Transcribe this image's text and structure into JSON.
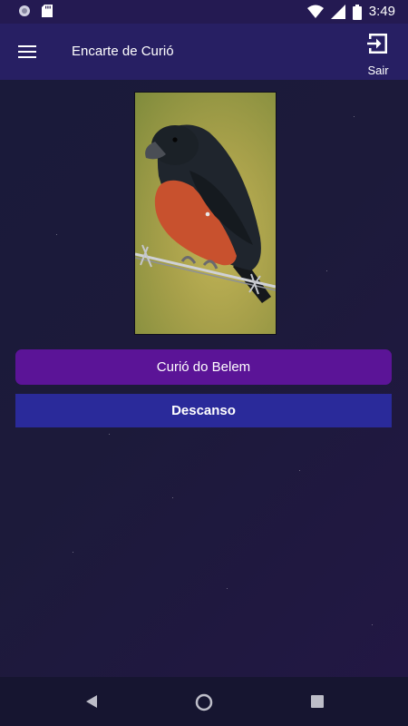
{
  "status_bar": {
    "time": "3:49",
    "icons": [
      "media-icon",
      "sd-card-icon",
      "wifi-icon",
      "cell-signal-icon",
      "battery-icon"
    ]
  },
  "app_bar": {
    "title": "Encarte de Curió",
    "menu_icon": "hamburger-menu-icon",
    "exit_icon": "exit-icon",
    "exit_label": "Sair"
  },
  "main": {
    "photo_icon": "bird-photo",
    "bird_name_button": "Curió do Belem",
    "rest_button": "Descanso"
  },
  "nav_bar": {
    "icons": [
      "back-icon",
      "home-icon",
      "recents-icon"
    ]
  },
  "colors": {
    "status_bar": "#241a52",
    "app_bar": "#271f63",
    "background": "#1a1a3a",
    "name_button": "#5b1497",
    "rest_button": "#2a2a9a"
  }
}
